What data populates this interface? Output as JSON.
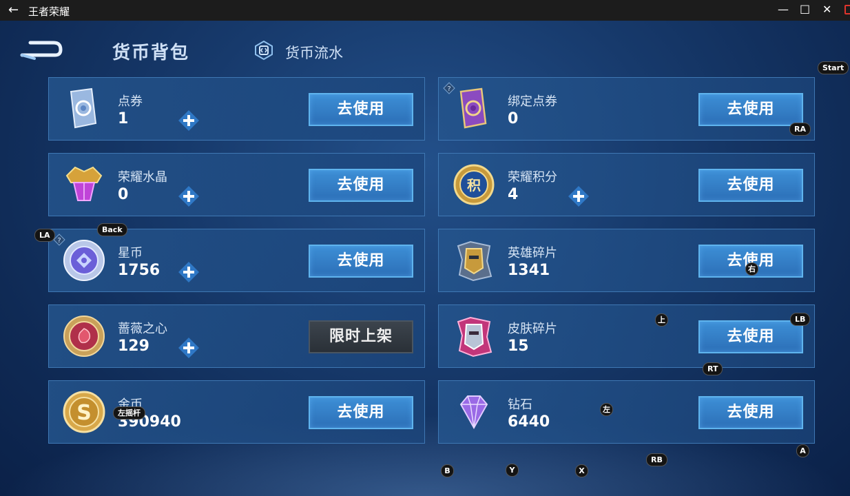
{
  "window": {
    "title": "王者荣耀"
  },
  "header": {
    "tab_active": "货币背包",
    "tab_flow": "货币流水"
  },
  "currencies": [
    {
      "name": "点券",
      "amount": "1",
      "action": "去使用"
    },
    {
      "name": "绑定点券",
      "amount": "0",
      "action": "去使用"
    },
    {
      "name": "荣耀水晶",
      "amount": "0",
      "action": "去使用"
    },
    {
      "name": "荣耀积分",
      "amount": "4",
      "action": "去使用"
    },
    {
      "name": "星币",
      "amount": "1756",
      "action": "去使用"
    },
    {
      "name": "英雄碎片",
      "amount": "1341",
      "action": "去使用"
    },
    {
      "name": "蔷薇之心",
      "amount": "129",
      "action": "限时上架"
    },
    {
      "name": "皮肤碎片",
      "amount": "15",
      "action": "去使用"
    },
    {
      "name": "金币",
      "amount": "390940",
      "action": "去使用"
    },
    {
      "name": "钻石",
      "amount": "6440",
      "action": "去使用"
    }
  ],
  "gamepad": {
    "start": "Start",
    "ra": "RA",
    "la": "LA",
    "back": "Back",
    "right": "右",
    "up": "上",
    "lb": "LB",
    "rt": "RT",
    "left_stick": "左摇杆",
    "left": "左",
    "a": "A",
    "rb": "RB",
    "b": "B",
    "y": "Y",
    "x": "X"
  },
  "colors": {
    "accent": "#3d8fd6",
    "panel": "#24548c",
    "titlebar": "#1c1c1c"
  }
}
